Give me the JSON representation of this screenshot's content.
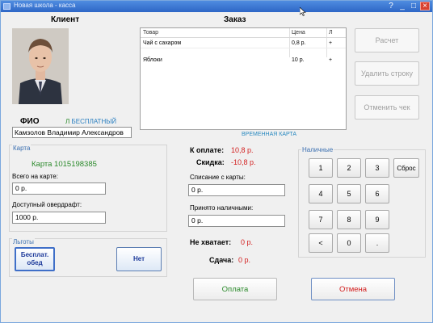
{
  "window": {
    "title": "Новая школа - касса",
    "accent": "#2e67c6"
  },
  "client": {
    "heading": "Клиент",
    "fio_label": "ФИО",
    "free_prefix": "Л",
    "free_label": "БЕСПЛАТНЫЙ",
    "fio_value": "Камзолов Владимир Александров"
  },
  "order": {
    "heading": "Заказ",
    "columns": [
      "Товар",
      "Цена",
      "Л"
    ],
    "rows": [
      {
        "name": "Чай с сахаром",
        "price": "0,8 р.",
        "mark": "+"
      },
      {
        "name": "Яблоки",
        "price": "10 р.",
        "mark": "+"
      }
    ],
    "card_type": "ВРЕМЕННАЯ КАРТА"
  },
  "actions": {
    "calculate": "Расчет",
    "delete_row": "Удалить строку",
    "cancel_check": "Отменить чек"
  },
  "card": {
    "legend": "Карта",
    "number": "Карта 1015198385",
    "total_label": "Всего на карте:",
    "total_value": "0 р.",
    "overdraft_label": "Доступный овердрафт:",
    "overdraft_value": "1000 р."
  },
  "benefits": {
    "legend": "Льготы",
    "free_lunch": "Бесплат. обед",
    "none": "Нет"
  },
  "payment": {
    "to_pay_label": "К оплате:",
    "to_pay_value": "10,8 р.",
    "discount_label": "Скидка:",
    "discount_value": "-10,8 р.",
    "card_debit_label": "Списание с карты:",
    "card_debit_value": "0 р.",
    "cash_received_label": "Принято наличными:",
    "cash_received_value": "0 р.",
    "shortage_label": "Не хватает:",
    "shortage_value": "0 р.",
    "change_label": "Сдача:",
    "change_value": "0 р."
  },
  "cash": {
    "legend": "Наличные",
    "keys": [
      "1",
      "2",
      "3",
      "4",
      "5",
      "6",
      "7",
      "8",
      "9",
      "<",
      "0",
      "."
    ],
    "reset": "Сброс"
  },
  "footer": {
    "pay": "Оплата",
    "cancel": "Отмена",
    "pay_color": "#2b8a2b",
    "cancel_color": "#d31f1f"
  }
}
